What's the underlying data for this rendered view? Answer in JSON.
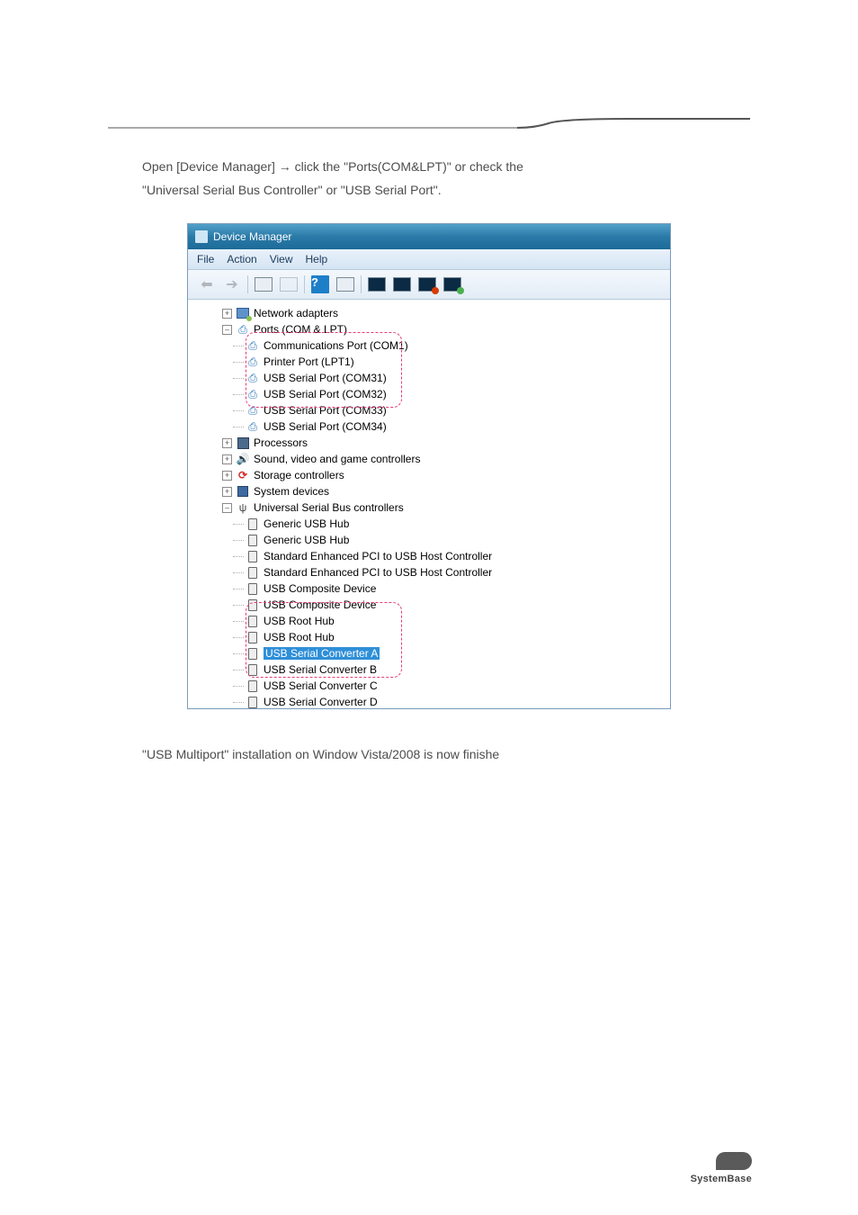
{
  "intro": {
    "line1_prefix": "Open [Device Manager] ",
    "arrow": "→",
    "line1_mid": " click the \"Ports(COM&LPT)\" or check the",
    "line2": "\"Universal Serial Bus Controller\" or \"USB Serial Port\"."
  },
  "devmgr": {
    "title": "Device Manager",
    "menu": {
      "file": "File",
      "action": "Action",
      "view": "View",
      "help": "Help"
    },
    "toolbar": {
      "help": "?"
    },
    "tree": {
      "network": "Network adapters",
      "ports": "Ports (COM & LPT)",
      "com1": "Communications Port (COM1)",
      "lpt1": "Printer Port (LPT1)",
      "sp31": "USB Serial Port (COM31)",
      "sp32": "USB Serial Port (COM32)",
      "sp33": "USB Serial Port (COM33)",
      "sp34": "USB Serial Port (COM34)",
      "proc": "Processors",
      "sound": "Sound, video and game controllers",
      "storage": "Storage controllers",
      "sysdev": "System devices",
      "usbc": "Universal Serial Bus controllers",
      "ghub1": "Generic USB Hub",
      "ghub2": "Generic USB Hub",
      "pci1": "Standard Enhanced PCI to USB Host Controller",
      "pci2": "Standard Enhanced PCI to USB Host Controller",
      "comp1": "USB Composite Device",
      "comp2": "USB Composite Device",
      "root1": "USB Root Hub",
      "root2": "USB Root Hub",
      "convA": "USB Serial Converter A",
      "convB": "USB Serial Converter B",
      "convC": "USB Serial Converter C",
      "convD": "USB Serial Converter D"
    }
  },
  "closing": "\"USB Multiport\" installation on Window Vista/2008 is now finishe",
  "footer": {
    "brand": "SystemBase"
  }
}
